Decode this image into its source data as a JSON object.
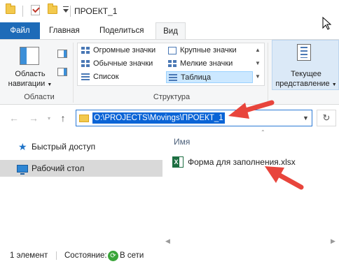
{
  "title_bar": {
    "window_title": "ПРОЕКТ_1",
    "quick_access_icons": [
      "folder-icon",
      "properties-checkbox-icon",
      "new-folder-icon",
      "customize-dropdown-icon"
    ]
  },
  "ribbon": {
    "tabs": [
      {
        "label": "Файл",
        "active": false,
        "color": "#1e6bb8"
      },
      {
        "label": "Главная",
        "active": false
      },
      {
        "label": "Поделиться",
        "active": false
      },
      {
        "label": "Вид",
        "active": true
      }
    ],
    "panes_group": {
      "nav_pane_label_line1": "Область",
      "nav_pane_label_line2": "навигации",
      "group_label": "Области"
    },
    "layout_group": {
      "items": [
        {
          "label": "Огромные значки",
          "icon": "extra-large-icons-icon",
          "selected": false
        },
        {
          "label": "Крупные значки",
          "icon": "large-icons-icon",
          "selected": false
        },
        {
          "label": "Обычные значки",
          "icon": "medium-icons-icon",
          "selected": false
        },
        {
          "label": "Мелкие значки",
          "icon": "small-icons-icon",
          "selected": false
        },
        {
          "label": "Список",
          "icon": "list-icon",
          "selected": false
        },
        {
          "label": "Таблица",
          "icon": "details-icon",
          "selected": true
        }
      ],
      "group_label": "Структура"
    },
    "current_view": {
      "label_line1": "Текущее",
      "label_line2": "представление"
    }
  },
  "address_bar": {
    "path": "O:\\PROJECTS\\Movings\\ПРОЕКТ_1",
    "selected": true,
    "selection_color": "#0a64d6"
  },
  "nav_pane": {
    "items": [
      {
        "label": "Быстрый доступ",
        "icon": "star-icon",
        "selected": false
      },
      {
        "label": "Рабочий стол",
        "icon": "desktop-icon",
        "selected": true
      }
    ]
  },
  "file_list": {
    "column_header": "Имя",
    "files": [
      {
        "name": "Форма для заполнения.xlsx",
        "icon": "excel-file-icon"
      }
    ]
  },
  "status_bar": {
    "item_count": "1 элемент",
    "state_label": "Состояние:",
    "state_value": "В сети"
  },
  "colors": {
    "file_tab": "#1e6bb8",
    "accent": "#0a64d6",
    "annotation_arrow": "#e8453c"
  }
}
